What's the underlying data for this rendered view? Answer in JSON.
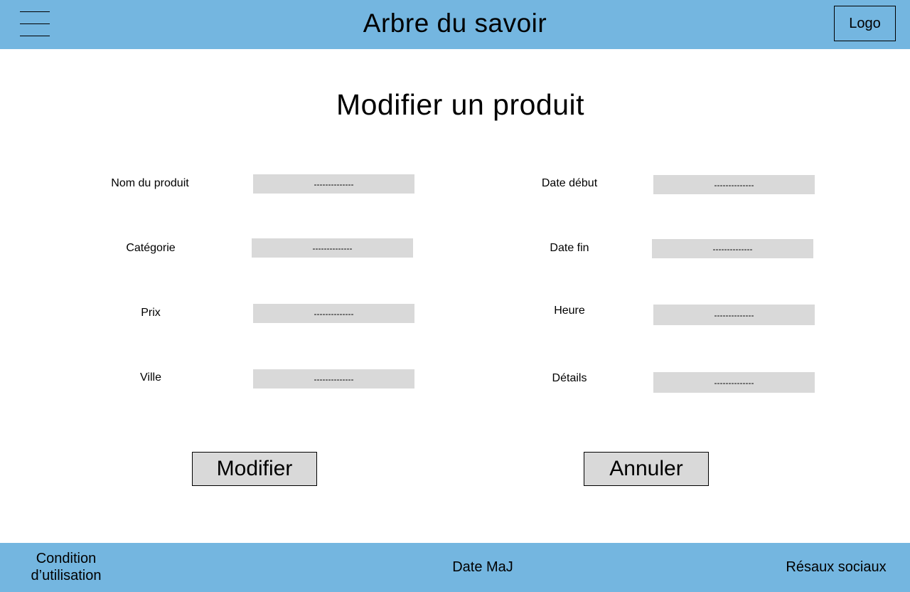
{
  "header": {
    "menu_icon": "hamburger-menu-icon",
    "title": "Arbre du savoir",
    "logo": "Logo"
  },
  "page_title": "Modifier un produit",
  "form": {
    "left": [
      {
        "label": "Nom du produit",
        "placeholder": "--------------"
      },
      {
        "label": "Catégorie",
        "placeholder": "--------------"
      },
      {
        "label": "Prix",
        "placeholder": "--------------"
      },
      {
        "label": "Ville",
        "placeholder": "--------------"
      }
    ],
    "right": [
      {
        "label": "Date début",
        "placeholder": "--------------"
      },
      {
        "label": "Date fin",
        "placeholder": "--------------"
      },
      {
        "label": "Heure",
        "placeholder": "--------------"
      },
      {
        "label": "Détails",
        "placeholder": "--------------"
      }
    ]
  },
  "actions": {
    "submit": "Modifier",
    "cancel": "Annuler"
  },
  "footer": {
    "terms_line1": "Condition",
    "terms_line2": "d’utilisation",
    "update_date": "Date MaJ",
    "social": "Résaux sociaux"
  },
  "colors": {
    "header_footer_bg": "#74b6e0",
    "field_bg": "#d9d9d9"
  }
}
